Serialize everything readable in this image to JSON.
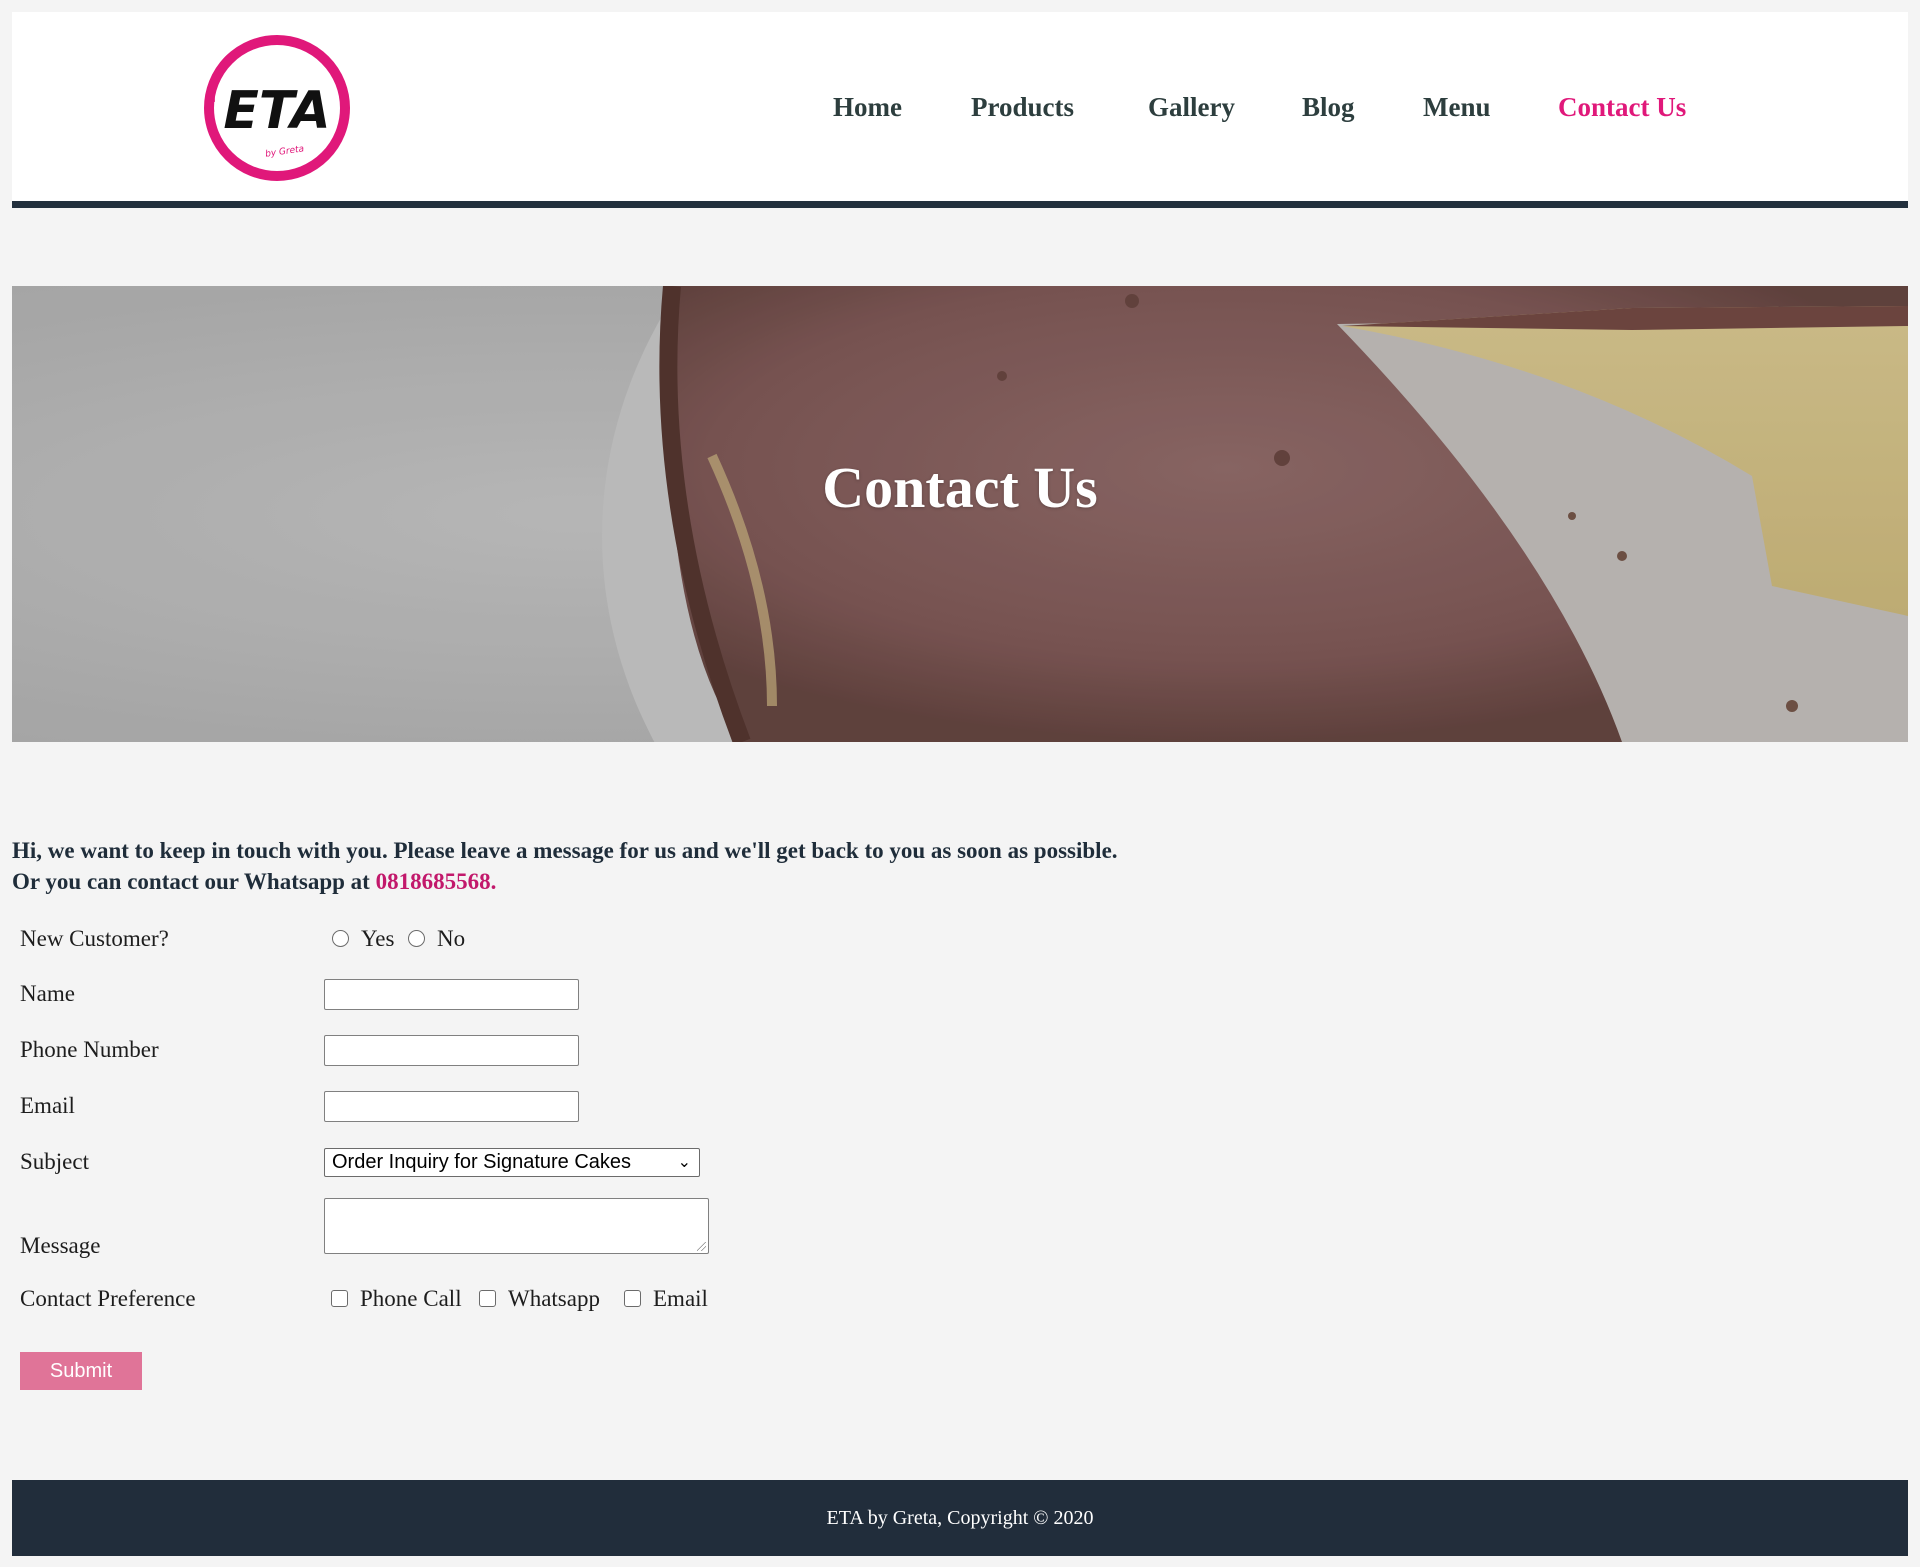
{
  "brand": {
    "logo_text": "ETA",
    "logo_subtext": "by Greta",
    "accent_color": "#e0187a"
  },
  "nav": {
    "items": [
      {
        "label": "Home"
      },
      {
        "label": "Products"
      },
      {
        "label": "Gallery"
      },
      {
        "label": "Blog"
      },
      {
        "label": "Menu"
      },
      {
        "label": "Contact Us",
        "active": true
      }
    ]
  },
  "hero": {
    "title": "Contact Us"
  },
  "intro": {
    "line1": "Hi, we want to keep in touch with you. Please leave a message for us and we'll get back to you as soon as possible.",
    "line2_prefix": "Or you can contact our Whatsapp at ",
    "phone": "0818685568."
  },
  "form": {
    "new_customer": {
      "label": "New Customer?",
      "options": [
        "Yes",
        "No"
      ]
    },
    "name": {
      "label": "Name",
      "value": ""
    },
    "phone": {
      "label": "Phone Number",
      "value": ""
    },
    "email": {
      "label": "Email",
      "value": ""
    },
    "subject": {
      "label": "Subject",
      "selected": "Order Inquiry for Signature Cakes"
    },
    "message": {
      "label": "Message",
      "value": ""
    },
    "contact_preference": {
      "label": "Contact Preference",
      "options": [
        "Phone Call",
        "Whatsapp",
        "Email"
      ]
    },
    "submit_label": "Submit"
  },
  "footer": {
    "text": "ETA by Greta, Copyright © 2020"
  }
}
